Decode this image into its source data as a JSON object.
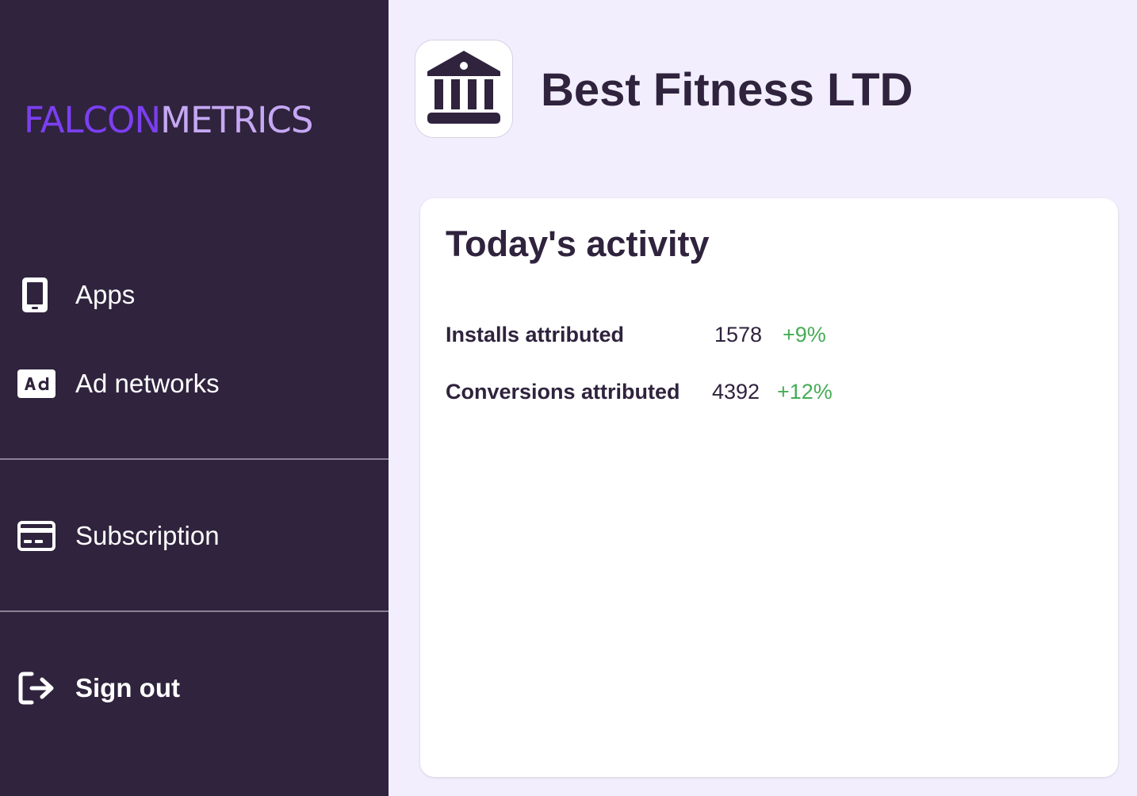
{
  "brand": {
    "logo_part1": "FALCON",
    "logo_part2": "METRICS",
    "accent_color": "#7b3ff0",
    "secondary_color": "#c6a8f4"
  },
  "sidebar": {
    "background": "#2f233d",
    "items": [
      {
        "label": "Apps",
        "icon": "smartphone-icon"
      },
      {
        "label": "Ad networks",
        "icon": "ad-icon"
      },
      {
        "label": "Subscription",
        "icon": "credit-card-icon"
      },
      {
        "label": "Sign out",
        "icon": "logout-icon"
      }
    ]
  },
  "header": {
    "company_name": "Best Fitness LTD",
    "company_icon": "bank-icon"
  },
  "activity": {
    "title": "Today's activity",
    "rows": [
      {
        "label": "Installs attributed",
        "value": "1578",
        "change": "+9%"
      },
      {
        "label": "Conversions attributed",
        "value": "4392",
        "change": "+12%"
      }
    ],
    "positive_color": "#46ac55"
  }
}
